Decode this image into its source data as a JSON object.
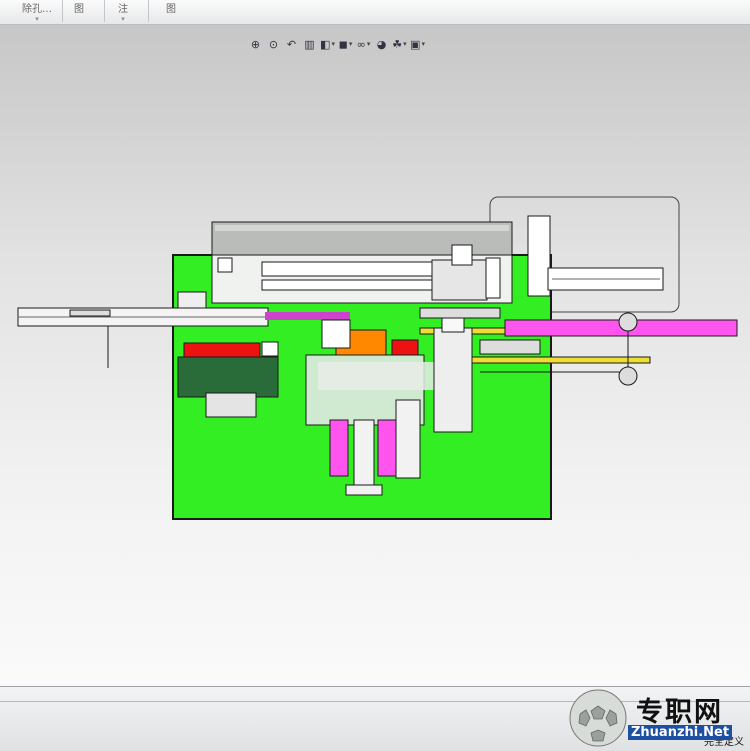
{
  "ribbon": {
    "items": [
      {
        "label": "除孔…",
        "icon": "hole-icon"
      },
      {
        "label": "图",
        "icon": "drawing-icon"
      },
      {
        "label": "注",
        "icon": "annotation-icon"
      },
      {
        "label": "图",
        "icon": "sheet-icon"
      }
    ]
  },
  "view_toolbar": {
    "buttons": [
      {
        "name": "zoom-to-fit-icon",
        "glyph": "⊕"
      },
      {
        "name": "zoom-area-icon",
        "glyph": "⊙"
      },
      {
        "name": "previous-view-icon",
        "glyph": "↶"
      },
      {
        "name": "section-view-icon",
        "glyph": "▥"
      },
      {
        "name": "view-orientation-icon",
        "glyph": "◧"
      },
      {
        "name": "display-style-icon",
        "glyph": "◼"
      },
      {
        "name": "hide-show-items-icon",
        "glyph": "∞"
      },
      {
        "name": "edit-appearance-icon",
        "glyph": "◕"
      },
      {
        "name": "apply-scene-icon",
        "glyph": "☘"
      },
      {
        "name": "view-settings-icon",
        "glyph": "▣"
      }
    ]
  },
  "status": {
    "text": "完全定义"
  },
  "watermark": {
    "brand": "专职网",
    "url": "Zhuanzhi.Net"
  },
  "colors": {
    "frame_green": "#33ee22",
    "pink": "#ff55ee",
    "red": "#ee1111",
    "orange": "#ff8800",
    "yellow": "#eedd33",
    "dark_green": "#2a6b3a",
    "outline": "#1a1a1a"
  }
}
